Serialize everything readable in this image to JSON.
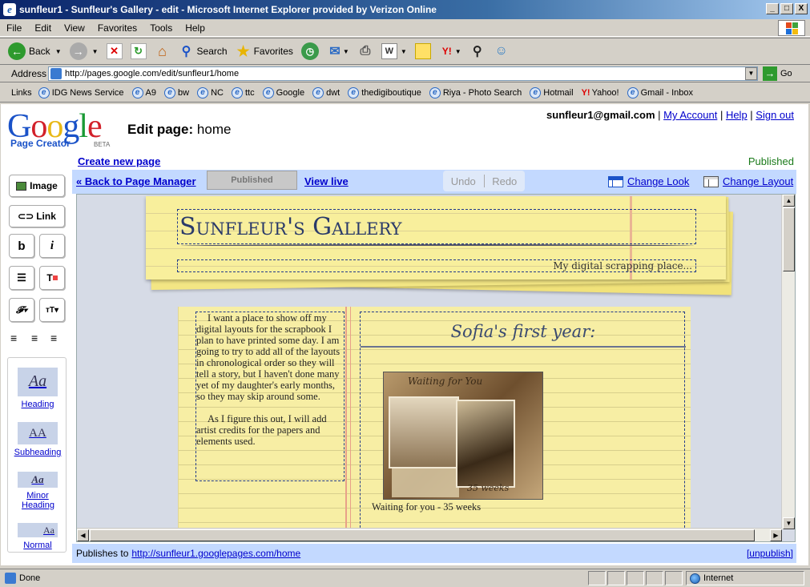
{
  "window": {
    "title": "sunfleur1 - Sunfleur's Gallery - edit - Microsoft Internet Explorer provided by Verizon Online",
    "min": "_",
    "max": "□",
    "close": "X"
  },
  "menu": [
    "File",
    "Edit",
    "View",
    "Favorites",
    "Tools",
    "Help"
  ],
  "toolbar": {
    "back": "Back",
    "search": "Search",
    "favorites": "Favorites"
  },
  "address": {
    "label": "Address",
    "url": "http://pages.google.com/edit/sunfleur1/home",
    "go": "Go"
  },
  "links": {
    "label": "Links",
    "items": [
      "IDG News Service",
      "A9",
      "bw",
      "NC",
      "ttc",
      "Google",
      "dwt",
      "thedigiboutique",
      "Riya - Photo Search",
      "Hotmail",
      "Yahoo!",
      "Gmail - Inbox"
    ]
  },
  "app": {
    "logo": "Google",
    "product": "Page Creator",
    "beta": "BETA",
    "edit_label": "Edit page:",
    "page_name": "home",
    "email": "sunfleur1@gmail.com",
    "my_account": "My Account",
    "help": "Help",
    "sign_out": "Sign out",
    "create_new": "Create new page",
    "status": "Published",
    "back": "« Back to Page Manager",
    "published_btn": "Published",
    "view_live": "View live",
    "undo": "Undo",
    "redo": "Redo",
    "change_look": "Change Look",
    "change_layout": "Change Layout"
  },
  "tools": {
    "image": "Image",
    "link": "Link",
    "bold": "b",
    "italic": "i",
    "styles": [
      {
        "sample": "Aa",
        "label": "Heading"
      },
      {
        "sample": "AA",
        "label": "Subheading"
      },
      {
        "sample": "Aa",
        "label": "Minor Heading"
      },
      {
        "sample": "Aa",
        "label": "Normal"
      }
    ]
  },
  "page": {
    "site_title": "Sunfleur's Gallery",
    "tagline": "My digital scrapping place...",
    "left_p1": "I want a place to show off my digital layouts for the scrapbook I plan to have printed some day. I am going to try to add all of the layouts in chronological order so they will tell a story, but I haven't done many yet of my daughter's early months, so they may skip around some.",
    "left_p2": "As I figure this out, I will add artist credits for the papers and elements used.",
    "right_heading": "Sofia's first year:",
    "photo_text1": "Waiting for You",
    "photo_text2": "35 weeks",
    "caption": "Waiting for you - 35 weeks"
  },
  "footer": {
    "publishes_to": "Publishes to",
    "url": "http://sunfleur1.googlepages.com/home",
    "unpublish": "[unpublish]"
  },
  "status": {
    "done": "Done",
    "zone": "Internet"
  }
}
